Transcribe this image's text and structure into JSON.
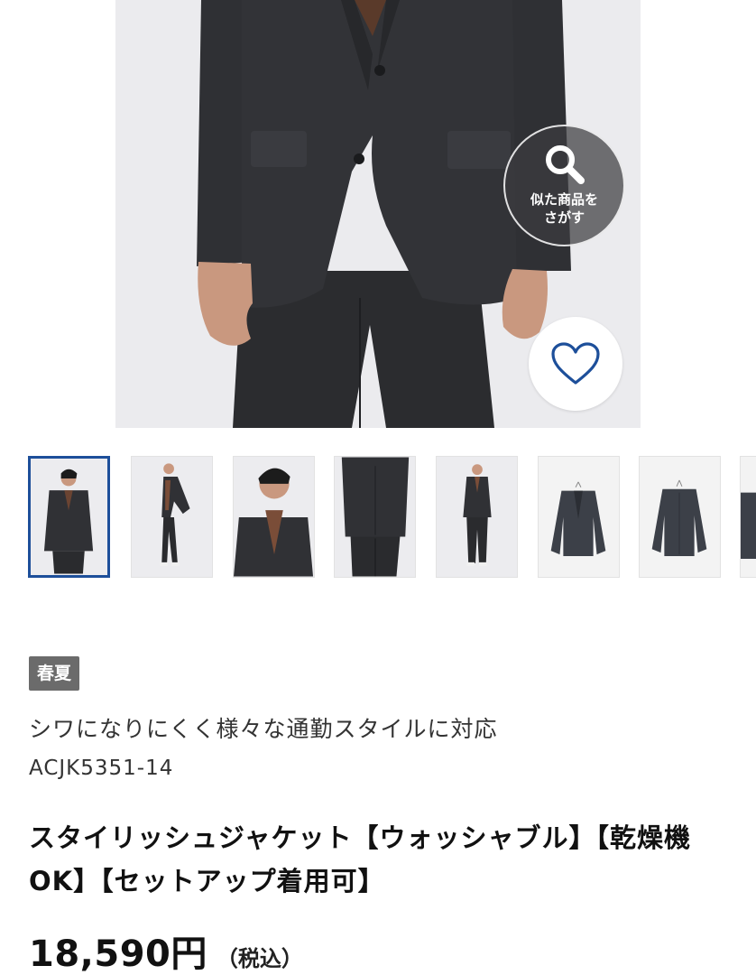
{
  "similar_search": {
    "label": "似た商品を\nさがす",
    "icon": "search-icon"
  },
  "favorite": {
    "icon": "heart-icon",
    "color": "#1d4f9a"
  },
  "thumbnails": [
    {
      "name": "thumb-model-front",
      "active": true
    },
    {
      "name": "thumb-model-walking",
      "active": false
    },
    {
      "name": "thumb-model-closeup",
      "active": false
    },
    {
      "name": "thumb-model-back",
      "active": false
    },
    {
      "name": "thumb-model-full-front",
      "active": false
    },
    {
      "name": "thumb-flat-front",
      "active": false
    },
    {
      "name": "thumb-flat-back",
      "active": false
    },
    {
      "name": "thumb-flat-detail",
      "active": false
    }
  ],
  "product": {
    "season_badge": "春夏",
    "catch_copy": "シワになりにくく様々な通勤スタイルに対応",
    "code": "ACJK5351-14",
    "title": "スタイリッシュジャケット【ウォッシャブル】【乾燥機OK】【セットアップ着用可】",
    "price": "18,590円",
    "tax_note": "（税込）"
  },
  "colors": {
    "accent": "#1d4f9a",
    "badge_bg": "#6b6b6b",
    "suit": "#2d2e31",
    "image_bg": "#ebebee"
  }
}
